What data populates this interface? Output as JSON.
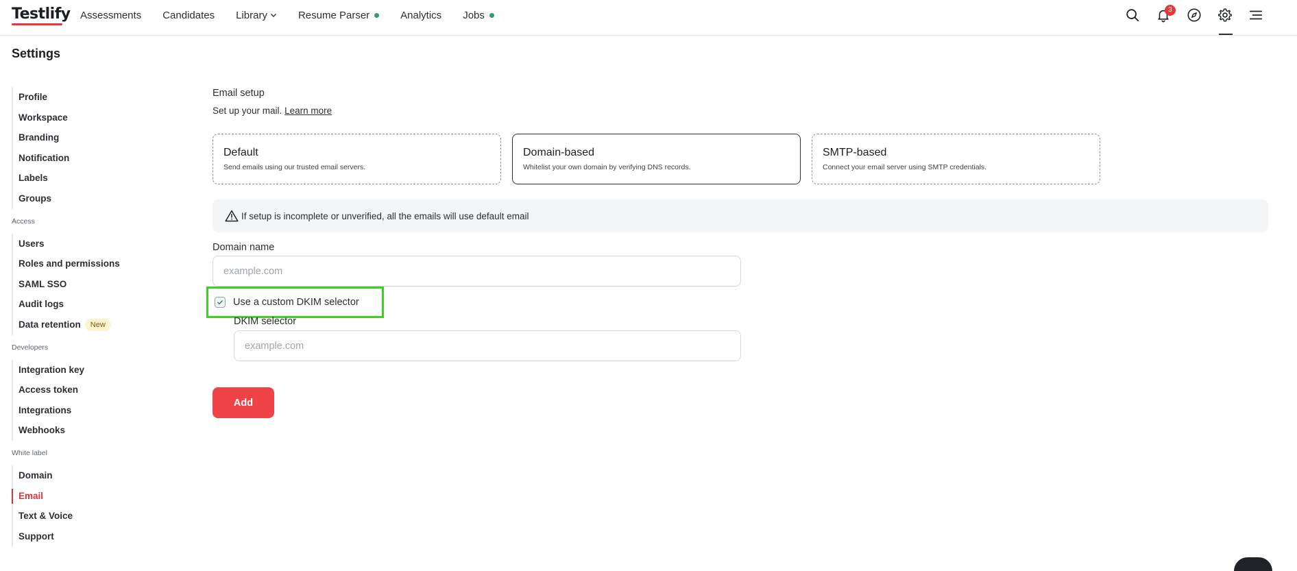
{
  "app": {
    "logo": "Testlify"
  },
  "nav": {
    "items": [
      {
        "label": "Assessments"
      },
      {
        "label": "Candidates"
      },
      {
        "label": "Library"
      },
      {
        "label": "Resume Parser"
      },
      {
        "label": "Analytics"
      },
      {
        "label": "Jobs"
      }
    ],
    "notification_count": "3",
    "dot_color": "#2e9e6a"
  },
  "page": {
    "title": "Settings"
  },
  "sidebar": {
    "group1": [
      "Profile",
      "Workspace",
      "Branding",
      "Notification",
      "Labels",
      "Groups"
    ],
    "access_heading": "Access",
    "access": [
      "Users",
      "Roles and permissions",
      "SAML SSO",
      "Audit logs",
      "Data retention"
    ],
    "new_badge": "New",
    "developers_heading": "Developers",
    "developers": [
      "Integration key",
      "Access token",
      "Integrations",
      "Webhooks"
    ],
    "white_label_heading": "White label",
    "white_label": [
      "Domain",
      "Email",
      "Text & Voice",
      "Support"
    ],
    "active_item": "Email"
  },
  "email_setup": {
    "title": "Email setup",
    "subtitle": "Set up your mail.",
    "learn_more": "Learn more",
    "cards": [
      {
        "title": "Default",
        "desc": "Send emails using our trusted email servers."
      },
      {
        "title": "Domain-based",
        "desc": "Whitelist your own domain by verifying DNS records."
      },
      {
        "title": "SMTP-based",
        "desc": "Connect your email server using SMTP credentials."
      }
    ],
    "selected_card": "Domain-based",
    "notice": "If setup is incomplete or unverified, all the emails will use default email",
    "domain_label": "Domain name",
    "domain_placeholder": "example.com",
    "custom_dkim_label": "Use a custom DKIM selector",
    "custom_dkim_checked": true,
    "dkim_label": "DKIM selector",
    "dkim_placeholder": "example.com",
    "add_button": "Add"
  },
  "colors": {
    "accent": "#ef4348",
    "active": "#d63436",
    "highlight": "#3ad11f"
  }
}
